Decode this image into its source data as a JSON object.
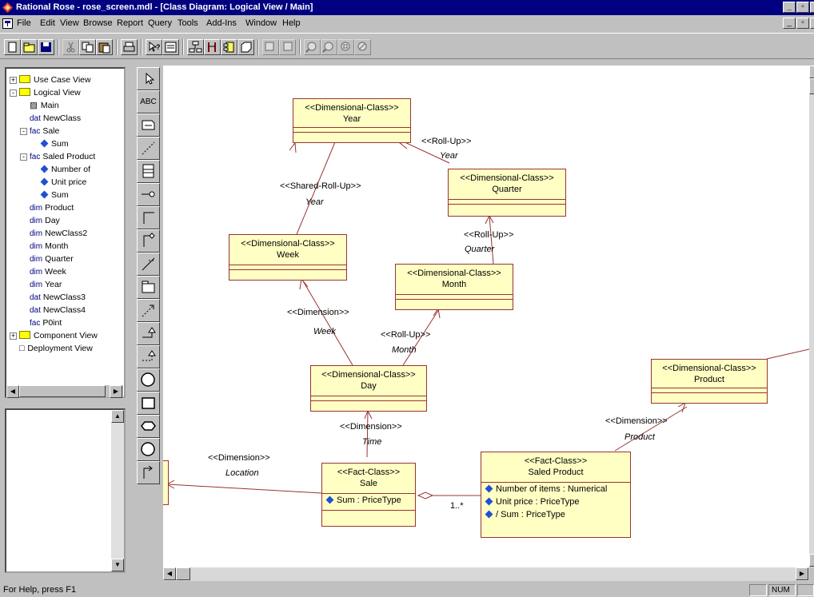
{
  "window": {
    "title": "Rational Rose - rose_screen.mdl - [Class Diagram: Logical View / Main]"
  },
  "menu": [
    {
      "label": "File"
    },
    {
      "label": "Edit"
    },
    {
      "label": "View"
    },
    {
      "label": "Browse"
    },
    {
      "label": "Report"
    },
    {
      "label": "Query"
    },
    {
      "label": "Tools"
    },
    {
      "label": "Add-Ins"
    },
    {
      "label": "Window"
    },
    {
      "label": "Help"
    }
  ],
  "tree": [
    {
      "key": "",
      "label": "Use Case View"
    },
    {
      "key": "",
      "label": "Logical View"
    },
    {
      "key": "",
      "label": "Main"
    },
    {
      "key": "dat",
      "label": "NewClass"
    },
    {
      "key": "fac",
      "label": "Sale"
    },
    {
      "key": "",
      "label": "Sum"
    },
    {
      "key": "fac",
      "label": "Saled Product"
    },
    {
      "key": "",
      "label": "Number of"
    },
    {
      "key": "",
      "label": "Unit price"
    },
    {
      "key": "",
      "label": "Sum"
    },
    {
      "key": "dim",
      "label": "Product"
    },
    {
      "key": "dim",
      "label": "Day"
    },
    {
      "key": "dim",
      "label": "NewClass2"
    },
    {
      "key": "dim",
      "label": "Month"
    },
    {
      "key": "dim",
      "label": "Quarter"
    },
    {
      "key": "dim",
      "label": "Week"
    },
    {
      "key": "dim",
      "label": "Year"
    },
    {
      "key": "dat",
      "label": "NewClass3"
    },
    {
      "key": "dat",
      "label": "NewClass4"
    },
    {
      "key": "fac",
      "label": "P0int"
    },
    {
      "key": "",
      "label": "Component View"
    },
    {
      "key": "",
      "label": "Deployment View"
    }
  ],
  "palette": {
    "text_tool": "ABC"
  },
  "diagram": {
    "classes": {
      "year": {
        "stereotype": "<<Dimensional-Class>>",
        "name": "Year"
      },
      "quarter": {
        "stereotype": "<<Dimensional-Class>>",
        "name": "Quarter"
      },
      "week": {
        "stereotype": "<<Dimensional-Class>>",
        "name": "Week"
      },
      "month": {
        "stereotype": "<<Dimensional-Class>>",
        "name": "Month"
      },
      "day": {
        "stereotype": "<<Dimensional-Class>>",
        "name": "Day"
      },
      "product": {
        "stereotype": "<<Dimensional-Class>>",
        "name": "Product"
      },
      "sale": {
        "stereotype": "<<Fact-Class>>",
        "name": "Sale",
        "attrs": [
          "Sum : PriceType"
        ]
      },
      "saled_product": {
        "stereotype": "<<Fact-Class>>",
        "name": "Saled Product",
        "attrs": [
          "Number of items : Numerical",
          "Unit price : PriceType",
          "/ Sum : PriceType"
        ]
      }
    },
    "labels": {
      "rollup_year_st": "<<Roll-Up>>",
      "rollup_year_role": "Year",
      "shared_st": "<<Shared-Roll-Up>>",
      "shared_role": "Year",
      "rollup_quarter_st": "<<Roll-Up>>",
      "rollup_quarter_role": "Quarter",
      "dim_week_st": "<<Dimension>>",
      "dim_week_role": "Week",
      "rollup_month_st": "<<Roll-Up>>",
      "rollup_month_role": "Month",
      "dim_time_st": "<<Dimension>>",
      "dim_time_role": "Time",
      "dim_loc_st": "<<Dimension>>",
      "dim_loc_role": "Location",
      "dim_prod_st": "<<Dimension>>",
      "dim_prod_role": "Product",
      "multiplicity": "1..*"
    }
  },
  "status": {
    "help": "For Help, press F1",
    "num": "NUM"
  }
}
